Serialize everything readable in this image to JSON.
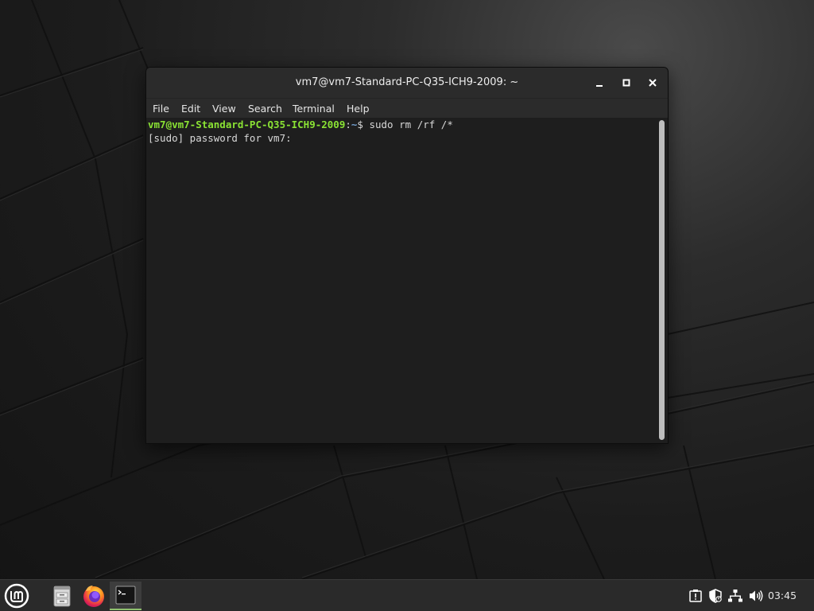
{
  "window": {
    "title": "vm7@vm7-Standard-PC-Q35-ICH9-2009: ~",
    "controls": {
      "minimize": "minimize-icon",
      "maximize": "maximize-icon",
      "close": "close-icon"
    }
  },
  "menubar": {
    "items": [
      "File",
      "Edit",
      "View",
      "Search",
      "Terminal",
      "Help"
    ]
  },
  "terminal": {
    "lines": [
      {
        "user_host": "vm7@vm7-Standard-PC-Q35-ICH9-2009",
        "separator": ":",
        "path": "~",
        "prompt_symbol": "$ ",
        "command": "sudo rm /rf /*"
      },
      {
        "output": "[sudo] password for vm7:"
      }
    ]
  },
  "taskbar": {
    "launchers": [
      "mint-menu-icon",
      "files-icon",
      "firefox-icon",
      "terminal-icon"
    ],
    "tray": [
      "updates-icon",
      "shield-icon",
      "network-icon",
      "volume-icon"
    ],
    "clock": "03:45"
  },
  "colors": {
    "prompt_user": "#8ae234",
    "prompt_path": "#729fcf",
    "accent": "#8fc16f"
  }
}
